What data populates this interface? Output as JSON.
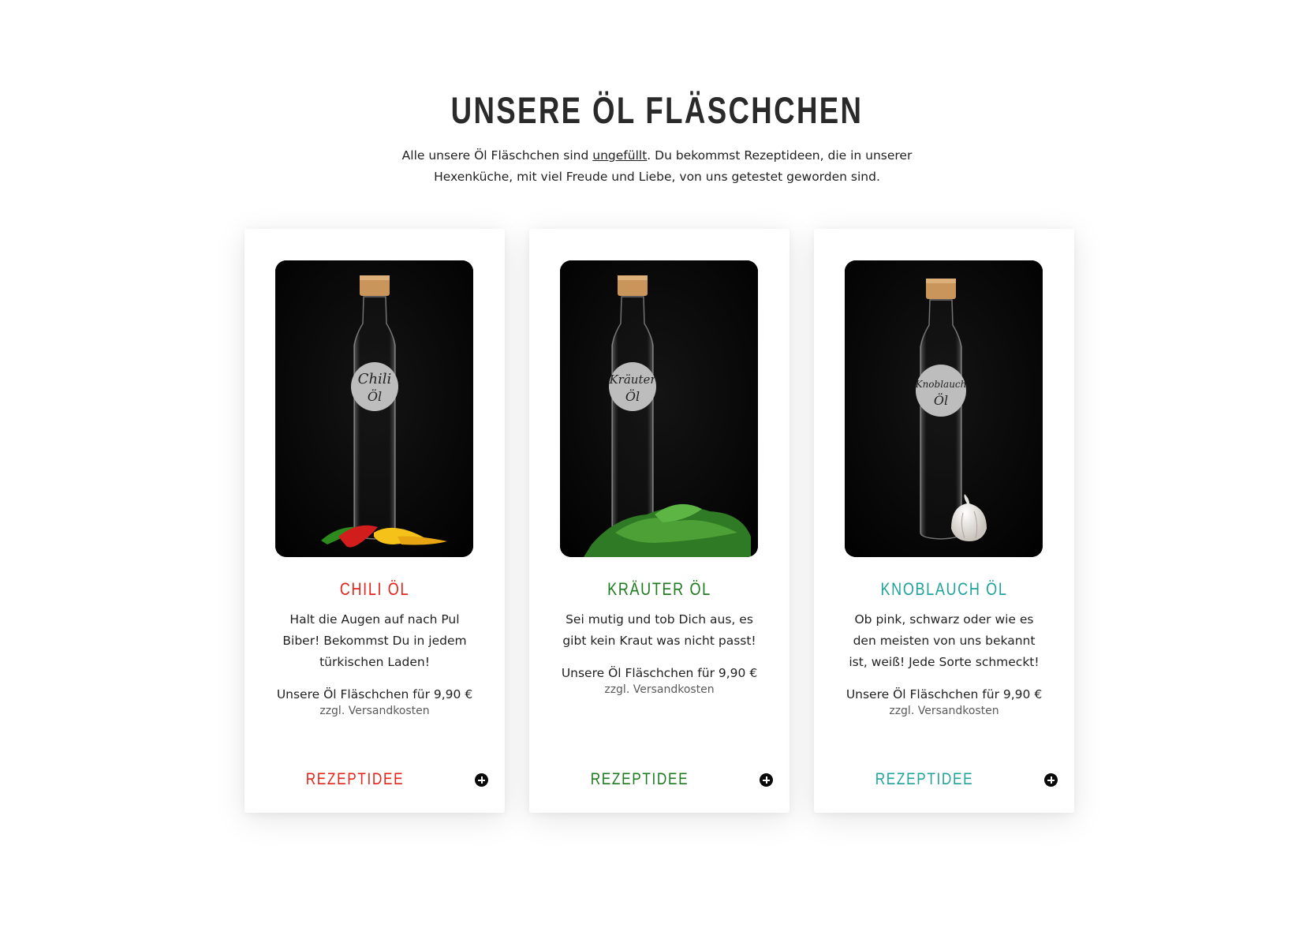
{
  "section": {
    "title": "UNSERE ÖL FLÄSCHCHEN",
    "intro_before": "Alle unsere Öl Fläschchen sind ",
    "intro_link": "ungefüllt",
    "intro_after": ". Du bekommst Rezeptideen, die in unserer Hexenküche, mit viel Freude und Liebe, von uns getestet geworden sind."
  },
  "products": [
    {
      "title": "CHILI ÖL",
      "label_line1": "Chili",
      "label_line2": "Öl",
      "description": "Halt die Augen auf nach Pul Biber! Bekommst Du in jedem türkischen Laden!",
      "price": "Unsere Öl Fläschchen für 9,90 €",
      "shipping": "zzgl. Versandkosten",
      "button": "REZEPTIDEE",
      "accent_color": "#e3241b",
      "icon": "plus-circle-icon"
    },
    {
      "title": "KRÄUTER ÖL",
      "label_line1": "Kräuter",
      "label_line2": "Öl",
      "description": "Sei mutig und tob Dich aus, es gibt kein Kraut was nicht passt!",
      "price": "Unsere Öl Fläschchen für 9,90 €",
      "shipping": "zzgl. Versandkosten",
      "button": "REZEPTIDEE",
      "accent_color": "#1e7a1e",
      "icon": "plus-circle-icon"
    },
    {
      "title": "KNOBLAUCH ÖL",
      "label_line1": "Knoblauch",
      "label_line2": "Öl",
      "description": "Ob pink, schwarz oder wie es den meisten von uns bekannt ist, weiß! Jede Sorte schmeckt!",
      "price": "Unsere Öl Fläschchen für 9,90 €",
      "shipping": "zzgl. Versandkosten",
      "button": "REZEPTIDEE",
      "accent_color": "#1fa39b",
      "icon": "plus-circle-icon"
    }
  ]
}
